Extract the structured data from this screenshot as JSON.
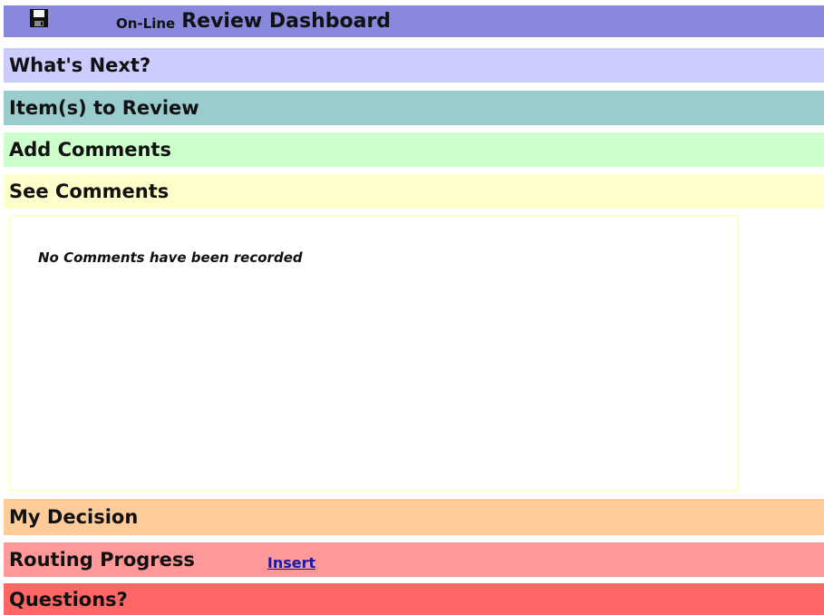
{
  "title": {
    "icon": "floppy-disk-save-icon",
    "prefix": "On-Line",
    "main": "Review Dashboard"
  },
  "sections": {
    "whats_next": "What's Next?",
    "items_to_review": "Item(s) to Review",
    "add_comments": "Add Comments",
    "see_comments": "See Comments",
    "my_decision": "My Decision",
    "routing_progress": "Routing Progress",
    "questions": "Questions?"
  },
  "comments": {
    "empty_message": "No Comments have been recorded"
  },
  "routing": {
    "insert_link": "Insert"
  },
  "colors": {
    "title_bar": "#8888dd",
    "whats_next": "#ccccff",
    "items_to_review": "#99cccc",
    "add_comments": "#ccffcc",
    "see_comments": "#ffffcc",
    "my_decision": "#ffcc99",
    "routing_progress": "#ff9999",
    "questions": "#ff6666",
    "link": "#1a1aa6"
  }
}
